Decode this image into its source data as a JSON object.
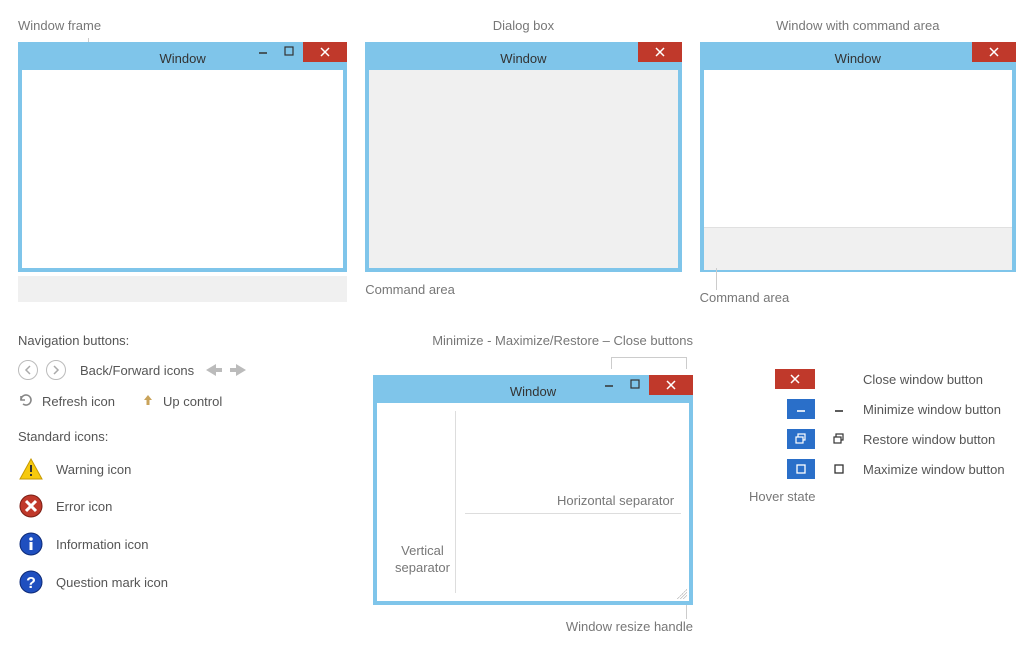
{
  "row1": {
    "window_frame_label": "Window frame",
    "dialog_box_label": "Dialog box",
    "window_cmd_label": "Window with command area",
    "window_title": "Window",
    "command_area_label": "Command area"
  },
  "nav": {
    "heading": "Navigation buttons:",
    "back_forward_label": "Back/Forward icons",
    "refresh_label": "Refresh icon",
    "up_label": "Up control"
  },
  "std": {
    "heading": "Standard icons:",
    "warning": "Warning icon",
    "error": "Error icon",
    "info": "Information icon",
    "question": "Question mark icon"
  },
  "mid": {
    "mmrc_label": "Minimize - Maximize/Restore – Close buttons",
    "window_title": "Window",
    "h_sep": "Horizontal separator",
    "v_sep_line1": "Vertical",
    "v_sep_line2": "separator",
    "resize_label": "Window resize handle"
  },
  "legend": {
    "close": "Close window button",
    "minimize": "Minimize window button",
    "restore": "Restore window button",
    "maximize": "Maximize window button",
    "hover": "Hover state"
  }
}
